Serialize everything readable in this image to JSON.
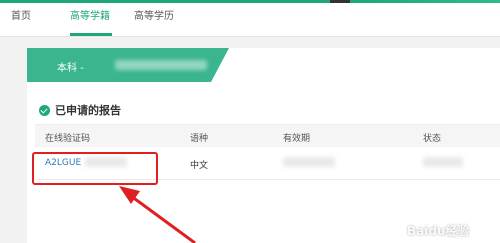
{
  "nav": {
    "tabs": [
      {
        "label": "首页",
        "active": false
      },
      {
        "label": "高等学籍",
        "active": true
      },
      {
        "label": "高等学历",
        "active": false
      }
    ]
  },
  "banner": {
    "label": "本科 -"
  },
  "section": {
    "title": "已申请的报告"
  },
  "table": {
    "headers": [
      "在线验证码",
      "语种",
      "有效期",
      "状态"
    ],
    "rows": [
      {
        "code": "A2LGUE",
        "language": "中文"
      }
    ]
  },
  "watermark": {
    "text": "Baidu经验"
  },
  "colors": {
    "accent": "#1fa67a",
    "banner": "#3ab58f",
    "annotation": "#e02020",
    "link": "#2a7bc0"
  }
}
